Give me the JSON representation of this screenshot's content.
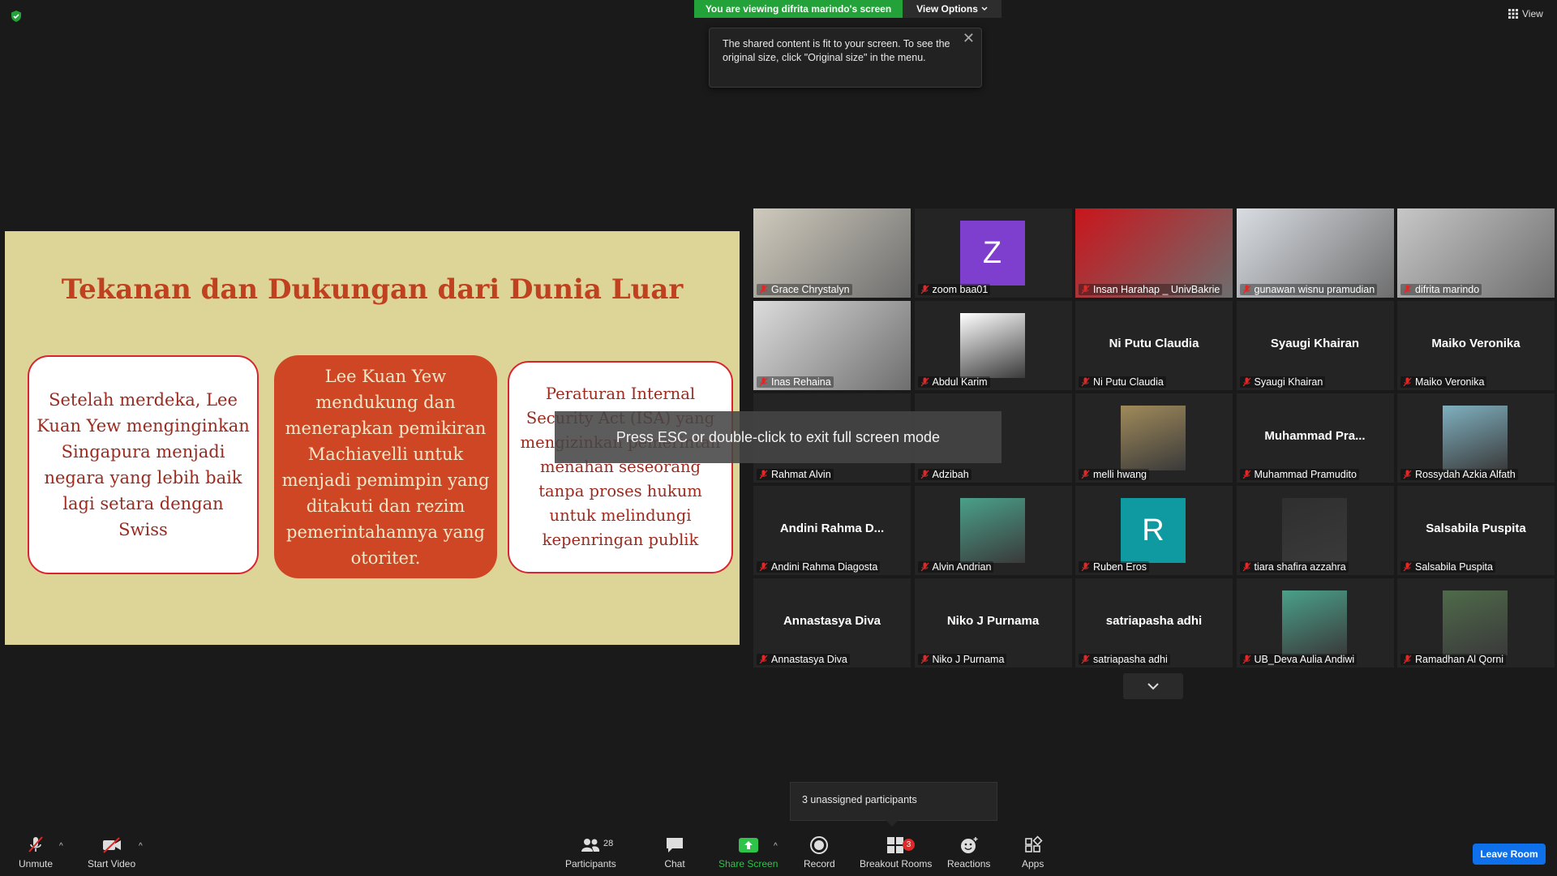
{
  "top": {
    "banner": "You are viewing difrita marindo's screen",
    "view_options": "View Options",
    "view_label": "View",
    "tooltip": "The shared content is fit to your screen. To see the original size, click \"Original size\" in the menu."
  },
  "slide": {
    "title": "Tekanan dan Dukungan dari Dunia Luar",
    "card1": "Setelah merdeka, Lee Kuan Yew menginginkan Singapura menjadi negara yang lebih baik lagi setara dengan Swiss",
    "card2": "Lee Kuan Yew mendukung dan menerapkan pemikiran Machiavelli untuk menjadi pemimpin yang ditakuti dan rezim pemerintahannya yang otoriter.",
    "card3": "Peraturan Internal Security Act (ISA) yang mengizinkan pemerintah menahan seseorang tanpa proses hukum untuk melindungi kepenringan publik",
    "colors": {
      "background": "#ddd597",
      "accent": "#c0411f",
      "card_border": "#d9232e"
    }
  },
  "overlay": {
    "esc_hint": "Press ESC or double-click to exit full screen mode",
    "ghost_name": "Adzibah"
  },
  "gallery": [
    {
      "label": "Grace Chrystalyn",
      "display": "",
      "kind": "photo",
      "active": true
    },
    {
      "label": "zoom baa01",
      "display": "Z",
      "kind": "letter",
      "color": "#7e3fcf"
    },
    {
      "label": "Insan Harahap _ UnivBakrie",
      "display": "",
      "kind": "photo"
    },
    {
      "label": "gunawan wisnu pramudian",
      "display": "",
      "kind": "photo"
    },
    {
      "label": "difrita marindo",
      "display": "",
      "kind": "photo"
    },
    {
      "label": "Inas Rehaina",
      "display": "",
      "kind": "photo"
    },
    {
      "label": "Abdul Karim",
      "display": "",
      "kind": "avatar"
    },
    {
      "label": "Ni Putu Claudia",
      "display": "Ni Putu Claudia",
      "kind": "name"
    },
    {
      "label": "Syaugi Khairan",
      "display": "Syaugi Khairan",
      "kind": "name"
    },
    {
      "label": "Maiko Veronika",
      "display": "Maiko Veronika",
      "kind": "name"
    },
    {
      "label": "Rahmat Alvin",
      "display": "",
      "kind": "name"
    },
    {
      "label": "Adzibah",
      "display": "",
      "kind": "name"
    },
    {
      "label": "melli hwang",
      "display": "",
      "kind": "avatar"
    },
    {
      "label": "Muhammad Pramudito",
      "display": "Muhammad  Pra...",
      "kind": "name"
    },
    {
      "label": "Rossydah Azkia Alfath",
      "display": "",
      "kind": "avatar"
    },
    {
      "label": "Andini Rahma Diagosta",
      "display": "Andini Rahma D...",
      "kind": "name"
    },
    {
      "label": "Alvin Andrian",
      "display": "",
      "kind": "avatar"
    },
    {
      "label": "Ruben Eros",
      "display": "R",
      "kind": "letter",
      "color": "#0f9aa2"
    },
    {
      "label": "tiara shafira azzahra",
      "display": "",
      "kind": "avatar"
    },
    {
      "label": "Salsabila Puspita",
      "display": "Salsabila Puspita",
      "kind": "name"
    },
    {
      "label": "Annastasya Diva",
      "display": "Annastasya Diva",
      "kind": "name"
    },
    {
      "label": "Niko J Purnama",
      "display": "Niko J Purnama",
      "kind": "name"
    },
    {
      "label": "satriapasha adhi",
      "display": "satriapasha adhi",
      "kind": "name"
    },
    {
      "label": "UB_Deva Aulia Andiwi",
      "display": "",
      "kind": "avatar"
    },
    {
      "label": "Ramadhan Al Qorni",
      "display": "",
      "kind": "avatar"
    }
  ],
  "unassigned": "3 unassigned participants",
  "toolbar": {
    "unmute": "Unmute",
    "start_video": "Start Video",
    "participants": "Participants",
    "participants_count": "28",
    "chat": "Chat",
    "share_screen": "Share Screen",
    "record": "Record",
    "breakout_rooms": "Breakout Rooms",
    "breakout_badge": "3",
    "reactions": "Reactions",
    "apps": "Apps",
    "leave": "Leave Room"
  }
}
